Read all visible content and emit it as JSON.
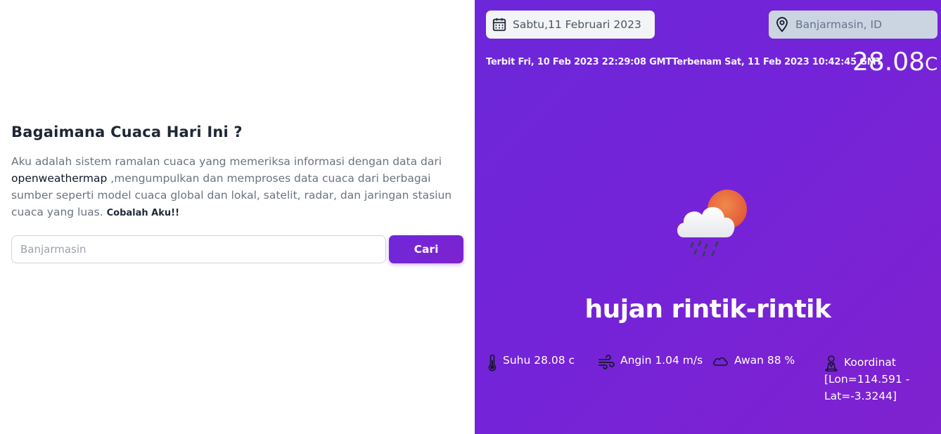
{
  "intro": {
    "heading": "Bagaimana Cuaca Hari Ini ?",
    "desc_part1": "Aku adalah sistem ramalan cuaca yang memeriksa informasi dengan data dari ",
    "desc_link": "openweathermap",
    "desc_part2": " ,mengumpulkan dan memproses data cuaca dari berbagai sumber seperti model cuaca global dan lokal, satelit, radar, dan jaringan stasiun cuaca yang luas. ",
    "desc_strong": "Cobalah Aku!!"
  },
  "search": {
    "placeholder": "Banjarmasin",
    "value": "",
    "button_label": "Cari"
  },
  "weather": {
    "date": "Sabtu,11 Februari 2023",
    "location": "Banjarmasin, ID",
    "sunrise": "Terbit Fri, 10 Feb 2023 22:29:08 GMT",
    "sunset": "Terbenam Sat, 11 Feb 2023 10:42:45 GMT",
    "temperature_value": "28.08",
    "temperature_unit": "C",
    "condition": "hujan rintik-rintik",
    "icon": "cloud-sun-drizzle-icon",
    "stats": {
      "suhu": "Suhu 28.08 c",
      "angin": "Angin 1.04 m/s",
      "awan": "Awan 88 %",
      "koordinat_label": "Koordinat",
      "koordinat_value": "[Lon=114.591 - Lat=-3.3244]"
    }
  },
  "colors": {
    "accent": "#6d28d9",
    "panel_gradient_start": "#6c27d9",
    "panel_gradient_end": "#7f22cf",
    "sun": "#e86a3d"
  }
}
